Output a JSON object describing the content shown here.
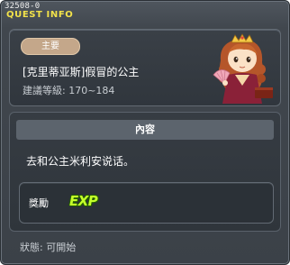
{
  "quest": {
    "id": "32508-0",
    "window_title": "QUEST INFO",
    "badge": "主要",
    "name": "[克里蒂亚斯]假冒的公主",
    "level_requirement": "建議等級: 170~184",
    "content_header": "內容",
    "description": "去和公主米利安说话。",
    "reward_label": "獎勵",
    "reward_item": "EXP",
    "status": "狀態: 可開始"
  },
  "colors": {
    "title": "#f2e24a",
    "badge": "#c4a78a",
    "exp": "#c4ff2a"
  },
  "icons": {
    "portrait": "princess-portrait-icon",
    "exp": "exp-icon"
  }
}
